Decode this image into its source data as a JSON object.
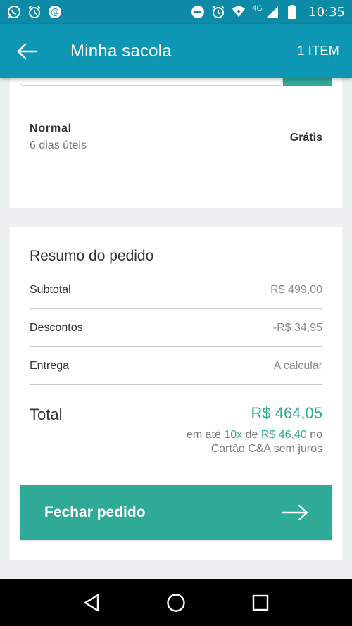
{
  "status_bar": {
    "time": "10:35",
    "network": "4G",
    "left_icons": [
      "whatsapp-icon",
      "alarm-icon",
      "at-sign-icon"
    ],
    "right_icons": [
      "do-not-disturb-icon",
      "alarm-icon",
      "wifi-icon",
      "signal-icon",
      "battery-icon"
    ]
  },
  "app_bar": {
    "title": "Minha sacola",
    "item_count": "1 ITEM"
  },
  "shipping": {
    "name": "Normal",
    "days": "6 dias úteis",
    "price": "Grátis"
  },
  "summary": {
    "title": "Resumo do pedido",
    "rows": [
      {
        "label": "Subtotal",
        "value": "R$ 499,00"
      },
      {
        "label": "Descontos",
        "value": "-R$ 34,95"
      },
      {
        "label": "Entrega",
        "value": "A calcular"
      }
    ],
    "total_label": "Total",
    "total_value": "R$ 464,05",
    "installment_prefix": "em até ",
    "installment_count": "10x",
    "installment_mid": " de ",
    "installment_amount": "R$ 46,40",
    "installment_suffix": " no",
    "installment_line2": "Cartão C&A sem juros"
  },
  "checkout_button": {
    "label": "Fechar pedido"
  },
  "colors": {
    "primary": "#0e96b5",
    "status_bar": "#0d8aa6",
    "accent": "#2eaa96"
  }
}
